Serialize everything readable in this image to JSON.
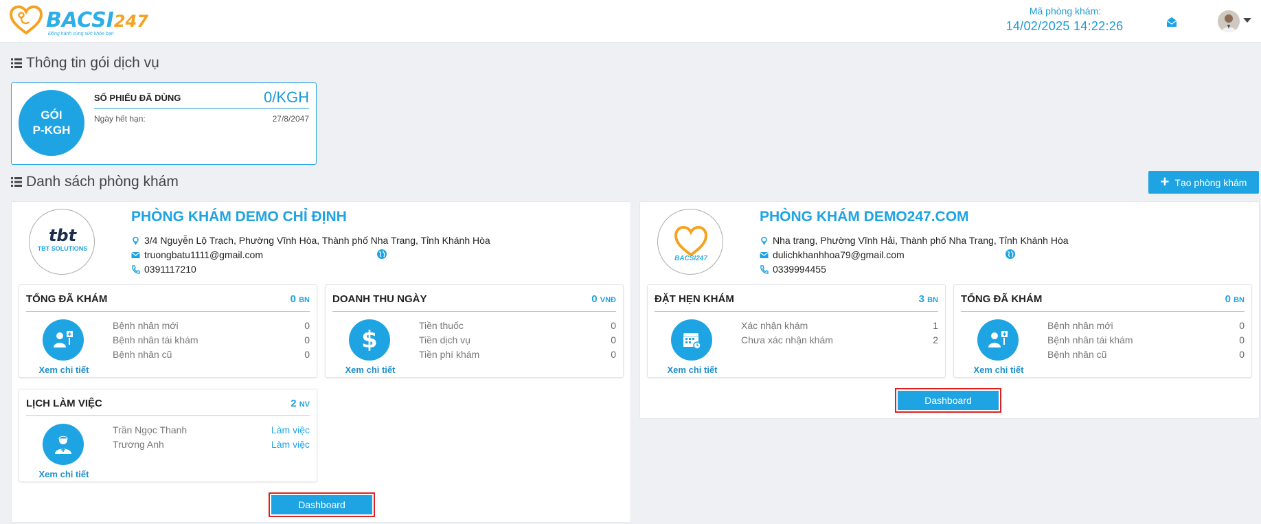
{
  "header": {
    "logo_text": "BACSI",
    "logo_num": "247",
    "logo_tagline": "Đồng hành cùng sức khỏe bạn",
    "clinic_code_label": "Mã phòng khám:",
    "datetime": "14/02/2025 14:22:26",
    "mail_icon": "envelope-icon",
    "avatar_icon": "user-avatar"
  },
  "package_section": {
    "title": "Thông tin gói dịch vụ",
    "circle_line1": "GÓI",
    "circle_line2": "P-KGH",
    "used_label": "SỐ PHIẾU ĐÃ DÙNG",
    "used_value": "0/KGH",
    "expiry_label": "Ngày hết hạn:",
    "expiry_value": "27/8/2047"
  },
  "clinic_section": {
    "title": "Danh sách phòng khám",
    "create_button": "Tạo phòng khám"
  },
  "clinics": [
    {
      "logo_caption": "TBT SOLUTIONS",
      "name": "PHÒNG KHÁM DEMO CHỈ ĐỊNH",
      "address": "3/4 Nguyễn Lộ Trạch, Phường Vĩnh Hòa, Thành phố Nha Trang, Tỉnh Khánh Hòa",
      "email": "truongbatu1111@gmail.com",
      "phone": "0391117210",
      "stats": {
        "total": {
          "title": "TỔNG ĐÃ KHÁM",
          "value": "0",
          "unit": "BN",
          "link": "Xem chi tiết",
          "rows": [
            {
              "label": "Bệnh nhân mới",
              "value": "0"
            },
            {
              "label": "Bệnh nhân tái khám",
              "value": "0"
            },
            {
              "label": "Bệnh nhân cũ",
              "value": "0"
            }
          ]
        },
        "revenue": {
          "title": "DOANH THU NGÀY",
          "value": "0",
          "unit": "VNĐ",
          "link": "Xem chi tiết",
          "rows": [
            {
              "label": "Tiền thuốc",
              "value": "0"
            },
            {
              "label": "Tiền dịch vụ",
              "value": "0"
            },
            {
              "label": "Tiền phí khám",
              "value": "0"
            }
          ]
        },
        "schedule": {
          "title": "LỊCH LÀM VIỆC",
          "value": "2",
          "unit": "NV",
          "link": "Xem chi tiết",
          "rows": [
            {
              "label": "Trần Ngọc Thanh",
              "value": "Làm việc"
            },
            {
              "label": "Trương Anh",
              "value": "Làm việc"
            }
          ]
        }
      },
      "dashboard_button": "Dashboard"
    },
    {
      "logo_caption": "BACSI247",
      "name": "PHÒNG KHÁM DEMO247.COM",
      "address": "Nha trang, Phường Vĩnh Hải, Thành phố Nha Trang, Tỉnh Khánh Hòa",
      "email": "dulichkhanhhoa79@gmail.com",
      "phone": "0339994455",
      "stats": {
        "appointment": {
          "title": "ĐẶT HẸN KHÁM",
          "value": "3",
          "unit": "BN",
          "link": "Xem chi tiết",
          "rows": [
            {
              "label": "Xác nhận khám",
              "value": "1"
            },
            {
              "label": "Chưa xác nhận khám",
              "value": "2"
            }
          ]
        },
        "total": {
          "title": "TỔNG ĐÃ KHÁM",
          "value": "0",
          "unit": "BN",
          "link": "Xem chi tiết",
          "rows": [
            {
              "label": "Bệnh nhân mới",
              "value": "0"
            },
            {
              "label": "Bệnh nhân tái khám",
              "value": "0"
            },
            {
              "label": "Bệnh nhân cũ",
              "value": "0"
            }
          ]
        }
      },
      "dashboard_button": "Dashboard"
    }
  ],
  "colors": {
    "accent": "#1ea3e3",
    "logo_orange": "#f4a21f",
    "highlight_border": "#e0201f"
  }
}
